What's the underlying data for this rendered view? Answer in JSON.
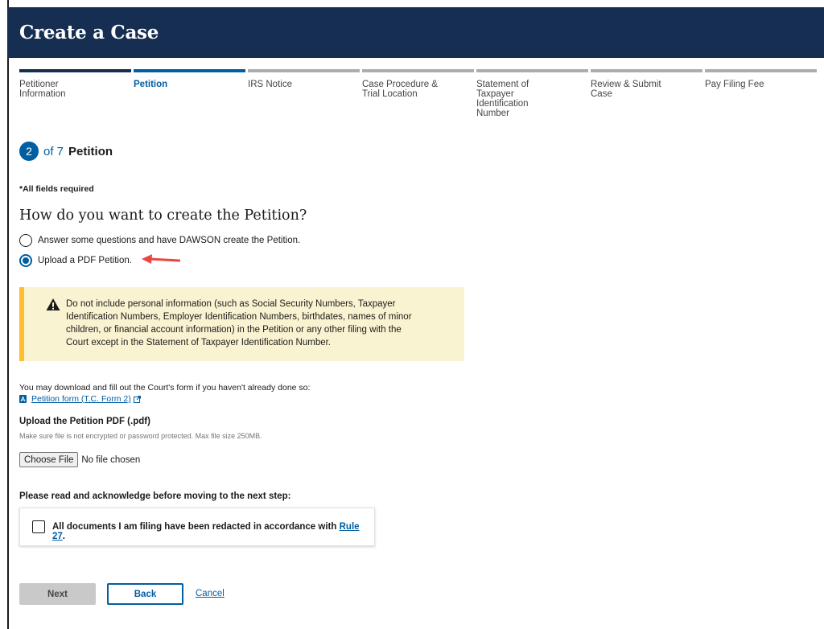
{
  "header": {
    "title": "Create a Case"
  },
  "stepper": {
    "steps": [
      {
        "label": "Petitioner Information",
        "state": "done"
      },
      {
        "label": "Petition",
        "state": "current"
      },
      {
        "label": "IRS Notice",
        "state": "todo"
      },
      {
        "label": "Case Procedure & Trial Location",
        "state": "todo"
      },
      {
        "label": "Statement of Taxpayer Identification Number",
        "state": "todo"
      },
      {
        "label": "Review & Submit Case",
        "state": "todo"
      },
      {
        "label": "Pay Filing Fee",
        "state": "todo"
      }
    ]
  },
  "progress": {
    "current": "2",
    "of_total": "of 7",
    "step_name": "Petition"
  },
  "form": {
    "required_note": "*All fields required",
    "question": "How do you want to create the Petition?",
    "options": [
      {
        "label": "Answer some questions and have DAWSON create the Petition.",
        "selected": false
      },
      {
        "label": "Upload a PDF Petition.",
        "selected": true
      }
    ],
    "warning": "Do not include personal information (such as Social Security Numbers, Taxpayer Identification Numbers, Employer Identification Numbers, birthdates, names of minor children, or financial account information) in the Petition or any other filing with the Court except in the Statement of Taxpayer Identification Number.",
    "download_text": "You may download and fill out the Court's form if you haven't already done so:",
    "download_link": "Petition form (T.C. Form 2)",
    "upload_label": "Upload the Petition PDF (.pdf)",
    "upload_hint": "Make sure file is not encrypted or password protected. Max file size 250MB.",
    "file_button": "Choose File",
    "file_status": "No file chosen",
    "ack_title": "Please read and acknowledge before moving to the next step:",
    "ack_text": "All documents I am filing have been redacted in accordance with",
    "ack_link": "Rule 27",
    "ack_suffix": "."
  },
  "actions": {
    "next": "Next",
    "back": "Back",
    "cancel": "Cancel"
  },
  "colors": {
    "header_bg": "#162e51",
    "primary": "#005ea2",
    "warning_bg": "#faf3d1",
    "warning_border": "#ffbe2e",
    "arrow": "#e8483f"
  }
}
